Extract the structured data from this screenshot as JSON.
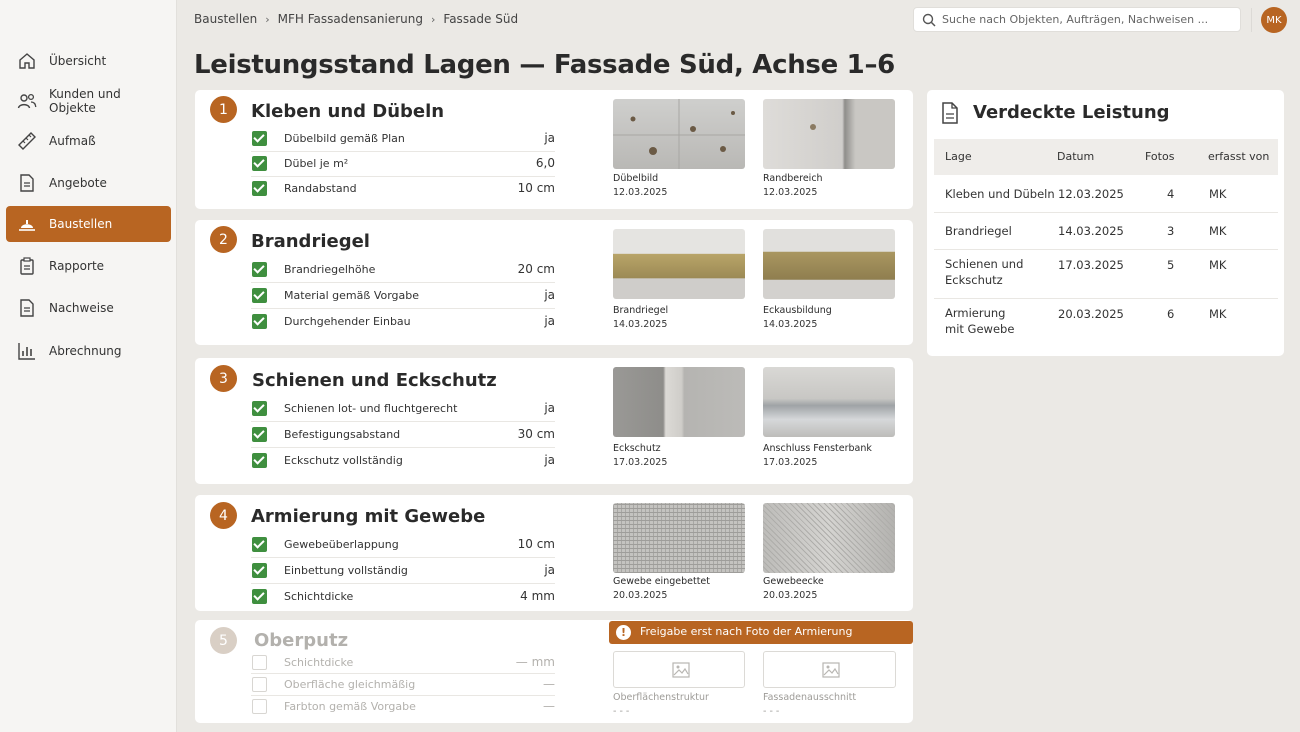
{
  "sidebar": {
    "items": [
      {
        "label": "Übersicht",
        "icon": "home-icon",
        "active": false
      },
      {
        "label": "Kunden und Objekte",
        "icon": "users-icon",
        "active": false
      },
      {
        "label": "Aufmaß",
        "icon": "ruler-icon",
        "active": false
      },
      {
        "label": "Angebote",
        "icon": "document-icon",
        "active": false
      },
      {
        "label": "Baustellen",
        "icon": "construction-icon",
        "active": true
      },
      {
        "label": "Rapporte",
        "icon": "clipboard-icon",
        "active": false
      },
      {
        "label": "Nachweise",
        "icon": "document-icon",
        "active": false
      },
      {
        "label": "Abrechnung",
        "icon": "chart-icon",
        "active": false
      }
    ]
  },
  "breadcrumb": [
    "Baustellen",
    "MFH Fassadensanierung",
    "Fassade Süd"
  ],
  "search": {
    "placeholder": "Suche nach Objekten, Aufträgen, Nachweisen ..."
  },
  "user": {
    "initials": "MK"
  },
  "page_title": "Leistungsstand Lagen — Fassade Süd, Achse 1–6",
  "accent_color": "#b86522",
  "check_color": "#3f8f3f",
  "layers": [
    {
      "number": "1",
      "title": "Kleben und Dübeln",
      "checks": [
        {
          "label": "Dübelbild gemäß Plan",
          "value": "ja"
        },
        {
          "label": "Dübel je m²",
          "value": "6,0"
        },
        {
          "label": "Randabstand",
          "value": "10 cm"
        }
      ],
      "photos": [
        {
          "caption": "Dübelbild",
          "date": "12.03.2025"
        },
        {
          "caption": "Randbereich",
          "date": "12.03.2025"
        }
      ]
    },
    {
      "number": "2",
      "title": "Brandriegel",
      "checks": [
        {
          "label": "Brandriegelhöhe",
          "value": "20 cm"
        },
        {
          "label": "Material gemäß Vorgabe",
          "value": "ja"
        },
        {
          "label": "Durchgehender Einbau",
          "value": "ja"
        }
      ],
      "photos": [
        {
          "caption": "Brandriegel",
          "date": "14.03.2025"
        },
        {
          "caption": "Eckausbildung",
          "date": "14.03.2025"
        }
      ]
    },
    {
      "number": "3",
      "title": "Schienen und Eckschutz",
      "checks": [
        {
          "label": "Schienen lot- und fluchtgerecht",
          "value": "ja"
        },
        {
          "label": "Befestigungsabstand",
          "value": "30 cm"
        },
        {
          "label": "Eckschutz vollständig",
          "value": "ja"
        }
      ],
      "photos": [
        {
          "caption": "Eckschutz",
          "date": "17.03.2025"
        },
        {
          "caption": "Anschluss Fensterbank",
          "date": "17.03.2025"
        }
      ]
    },
    {
      "number": "4",
      "title": "Armierung mit Gewebe",
      "checks": [
        {
          "label": "Gewebeüberlappung",
          "value": "10 cm"
        },
        {
          "label": "Einbettung vollständig",
          "value": "ja"
        },
        {
          "label": "Schichtdicke",
          "value": "4 mm"
        }
      ],
      "photos": [
        {
          "caption": "Gewebe eingebettet",
          "date": "20.03.2025"
        },
        {
          "caption": "Gewebeecke",
          "date": "20.03.2025"
        }
      ]
    },
    {
      "number": "5",
      "title": "Oberputz",
      "checks": [
        {
          "label": "Schichtdicke",
          "value": "— mm"
        },
        {
          "label": "Oberfläche gleichmäßig",
          "value": "—"
        },
        {
          "label": "Farbton gemäß Vorgabe",
          "value": "—"
        }
      ],
      "photos": [
        {
          "caption": "Oberflächenstruktur",
          "date": "- - -"
        },
        {
          "caption": "Fassadenausschnitt",
          "date": "- - -"
        }
      ],
      "notice": "Freigabe erst nach Foto der Armierung"
    }
  ],
  "covered_work": {
    "title": "Verdeckte Leistung",
    "columns": [
      "Lage",
      "Datum",
      "Fotos",
      "erfasst von"
    ],
    "rows": [
      {
        "lage": "Kleben und Dübeln",
        "datum": "12.03.2025",
        "fotos": "4",
        "von": "MK"
      },
      {
        "lage": "Brandriegel",
        "datum": "14.03.2025",
        "fotos": "3",
        "von": "MK"
      },
      {
        "lage": "Schienen und Eckschutz",
        "datum": "17.03.2025",
        "fotos": "5",
        "von": "MK"
      },
      {
        "lage": "Armierung mit Gewebe",
        "datum": "20.03.2025",
        "fotos": "6",
        "von": "MK"
      }
    ]
  }
}
